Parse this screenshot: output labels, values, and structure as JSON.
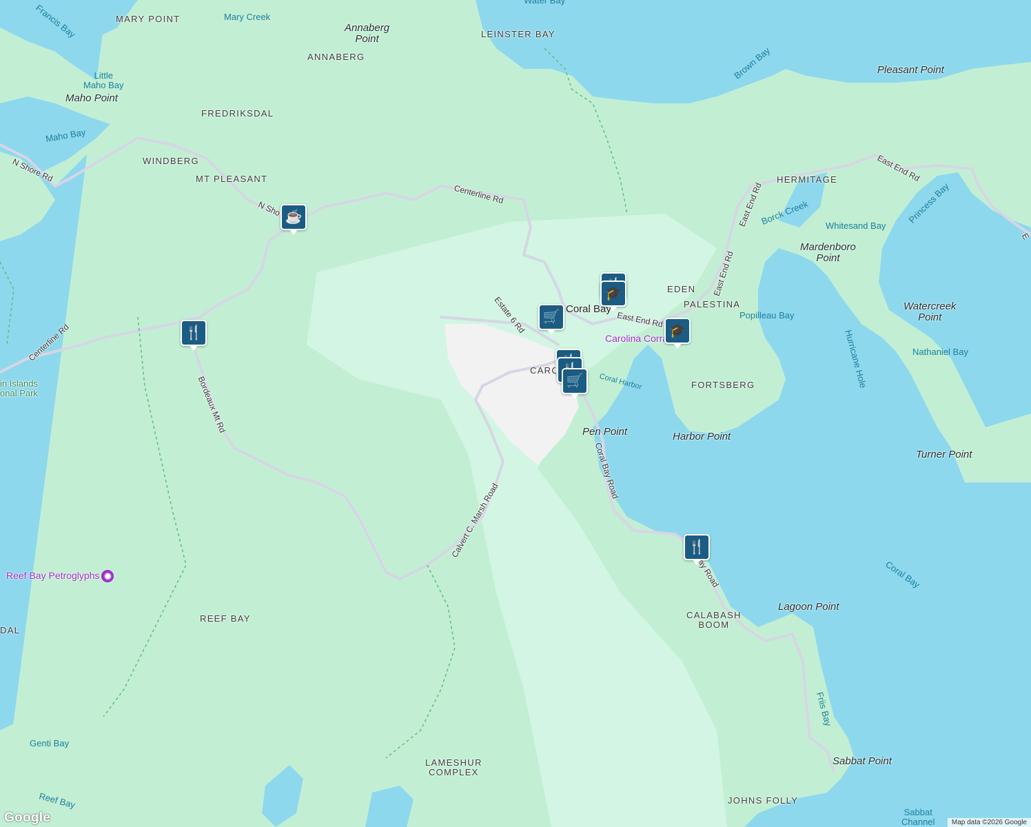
{
  "places": {
    "mary_point": "MARY POINT",
    "leinster_bay": "LEINSTER BAY",
    "annaberg": "ANNABERG",
    "fredriksdal": "FREDRIKSDAL",
    "windberg": "WINDBERG",
    "mt_pleasant": "MT PLEASANT",
    "hermitage": "HERMITAGE",
    "eden": "EDEN",
    "palestina": "PALESTINA",
    "fortsberg": "FORTSBERG",
    "reef_bay": "REEF BAY",
    "calabash_boom": "CALABASH\nBOOM",
    "lameshur_complex": "LAMESHUR\nCOMPLEX",
    "johns_folly": "JOHNS FOLLY",
    "dal": "DAL",
    "caro": "CARO"
  },
  "points": {
    "annaberg_point": "Annaberg\nPoint",
    "maho_point": "Maho Point",
    "pleasant_point": "Pleasant Point",
    "mardenboro_point": "Mardenboro\nPoint",
    "watercreek_point": "Watercreek\nPoint",
    "pen_point": "Pen Point",
    "harbor_point": "Harbor Point",
    "turner_point": "Turner Point",
    "lagoon_point": "Lagoon Point",
    "sabbat_point": "Sabbat Point"
  },
  "water": {
    "francis_bay": "Francis Bay",
    "mary_creek": "Mary Creek",
    "water_bay": "Water Bay",
    "little_maho_bay": "Little\nMaho Bay",
    "maho_bay": "Maho Bay",
    "brown_bay": "Brown Bay",
    "borck_creek": "Borck Creek",
    "whitesand_bay": "Whitesand Bay",
    "princess_bay": "Princess Bay",
    "popilleau_bay": "Popilleau Bay",
    "hurricane_hole": "Hurricane Hole",
    "nathaniel_bay": "Nathaniel Bay",
    "coral_harbor": "Coral Harbor",
    "coral_bay": "Coral Bay",
    "friis_bay": "Friis Bay",
    "genti_bay": "Genti Bay",
    "reef_bay_water": "Reef Bay",
    "sabbat_channel": "Sabbat\nChannel"
  },
  "roads": {
    "n_shore_rd": "N Shore Rd",
    "n_sho": "N Sho",
    "centerline_rd_top": "Centerline Rd",
    "centerline_rd_left": "Centerline Rd",
    "bordeaux_mt_rd": "Bordeaux Mt Rd",
    "estate_6_rd": "Estate 6 Rd",
    "east_end_rd_a": "East End Rd",
    "east_end_rd_b": "East End Rd",
    "east_end_rd_c": "East End Rd",
    "east_end_rd_d": "East End Rd",
    "coral_bay_road": "Coral Bay Road",
    "coral_bay_road_south": "Coral Bay Road",
    "calvert_marsh_road": "Calvert C. Marsh Road",
    "road_e": "E"
  },
  "town": "Coral Bay",
  "park": "in Islands\nonal Park",
  "pois": {
    "reef_bay_petroglyphs": "Reef Bay Petroglyphs",
    "carolina_corral": "Carolina Corral"
  },
  "markers": {
    "cafe": "cafe-icon",
    "restaurant": "restaurant-icon",
    "shopping": "shopping-cart-icon",
    "school": "school-icon",
    "camera": "camera-icon"
  },
  "attribution": "Map data ©2026 Google",
  "logo": "Google",
  "colors": {
    "water": "#8ed8ee",
    "land": "#c2efd4",
    "park_light": "#d2f6e3",
    "urban": "#f2f2f2",
    "road": "#d6d6e4",
    "marker": "#1b5c84",
    "poi_text": "#9b2fc4"
  }
}
